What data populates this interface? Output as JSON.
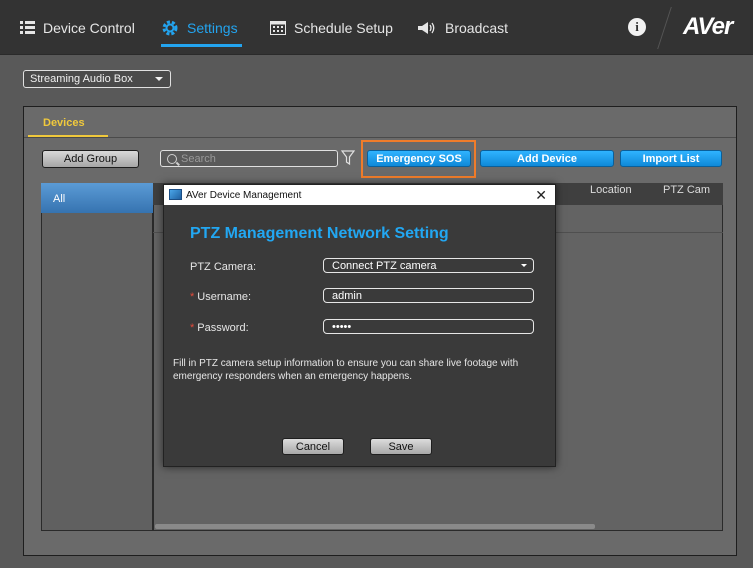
{
  "nav": {
    "items": [
      {
        "label": "Device Control",
        "icon": "list-icon"
      },
      {
        "label": "Settings",
        "icon": "gear-icon",
        "active": true
      },
      {
        "label": "Schedule Setup",
        "icon": "calendar-icon"
      },
      {
        "label": "Broadcast",
        "icon": "megaphone-icon"
      }
    ],
    "info_label": "i",
    "logo": "AVer"
  },
  "device_select": {
    "value": "Streaming Audio Box"
  },
  "tabs": {
    "devices": "Devices"
  },
  "toolbar": {
    "add_group": "Add Group",
    "search_placeholder": "Search",
    "emergency_sos": "Emergency SOS",
    "add_device": "Add Device",
    "import_list": "Import List"
  },
  "table": {
    "group_header": "All",
    "columns": [
      "Location",
      "PTZ Cam"
    ]
  },
  "dialog": {
    "window_title": "AVer Device Management",
    "close_label": "✕",
    "heading": "PTZ Management Network Setting",
    "fields": {
      "ptz_camera": {
        "label": "PTZ Camera:",
        "value": "Connect PTZ camera"
      },
      "username": {
        "label": "Username:",
        "value": "admin"
      },
      "password": {
        "label": "Password:",
        "value": "•••••"
      }
    },
    "required_mark": "*",
    "note": "Fill in PTZ camera setup information to ensure you can share live footage with emergency responders when an emergency happens.",
    "cancel": "Cancel",
    "save": "Save"
  },
  "colors": {
    "accent": "#23a4ef",
    "tab_active": "#f0c93c",
    "highlight": "#f07c2a",
    "required": "#e34a3b"
  }
}
